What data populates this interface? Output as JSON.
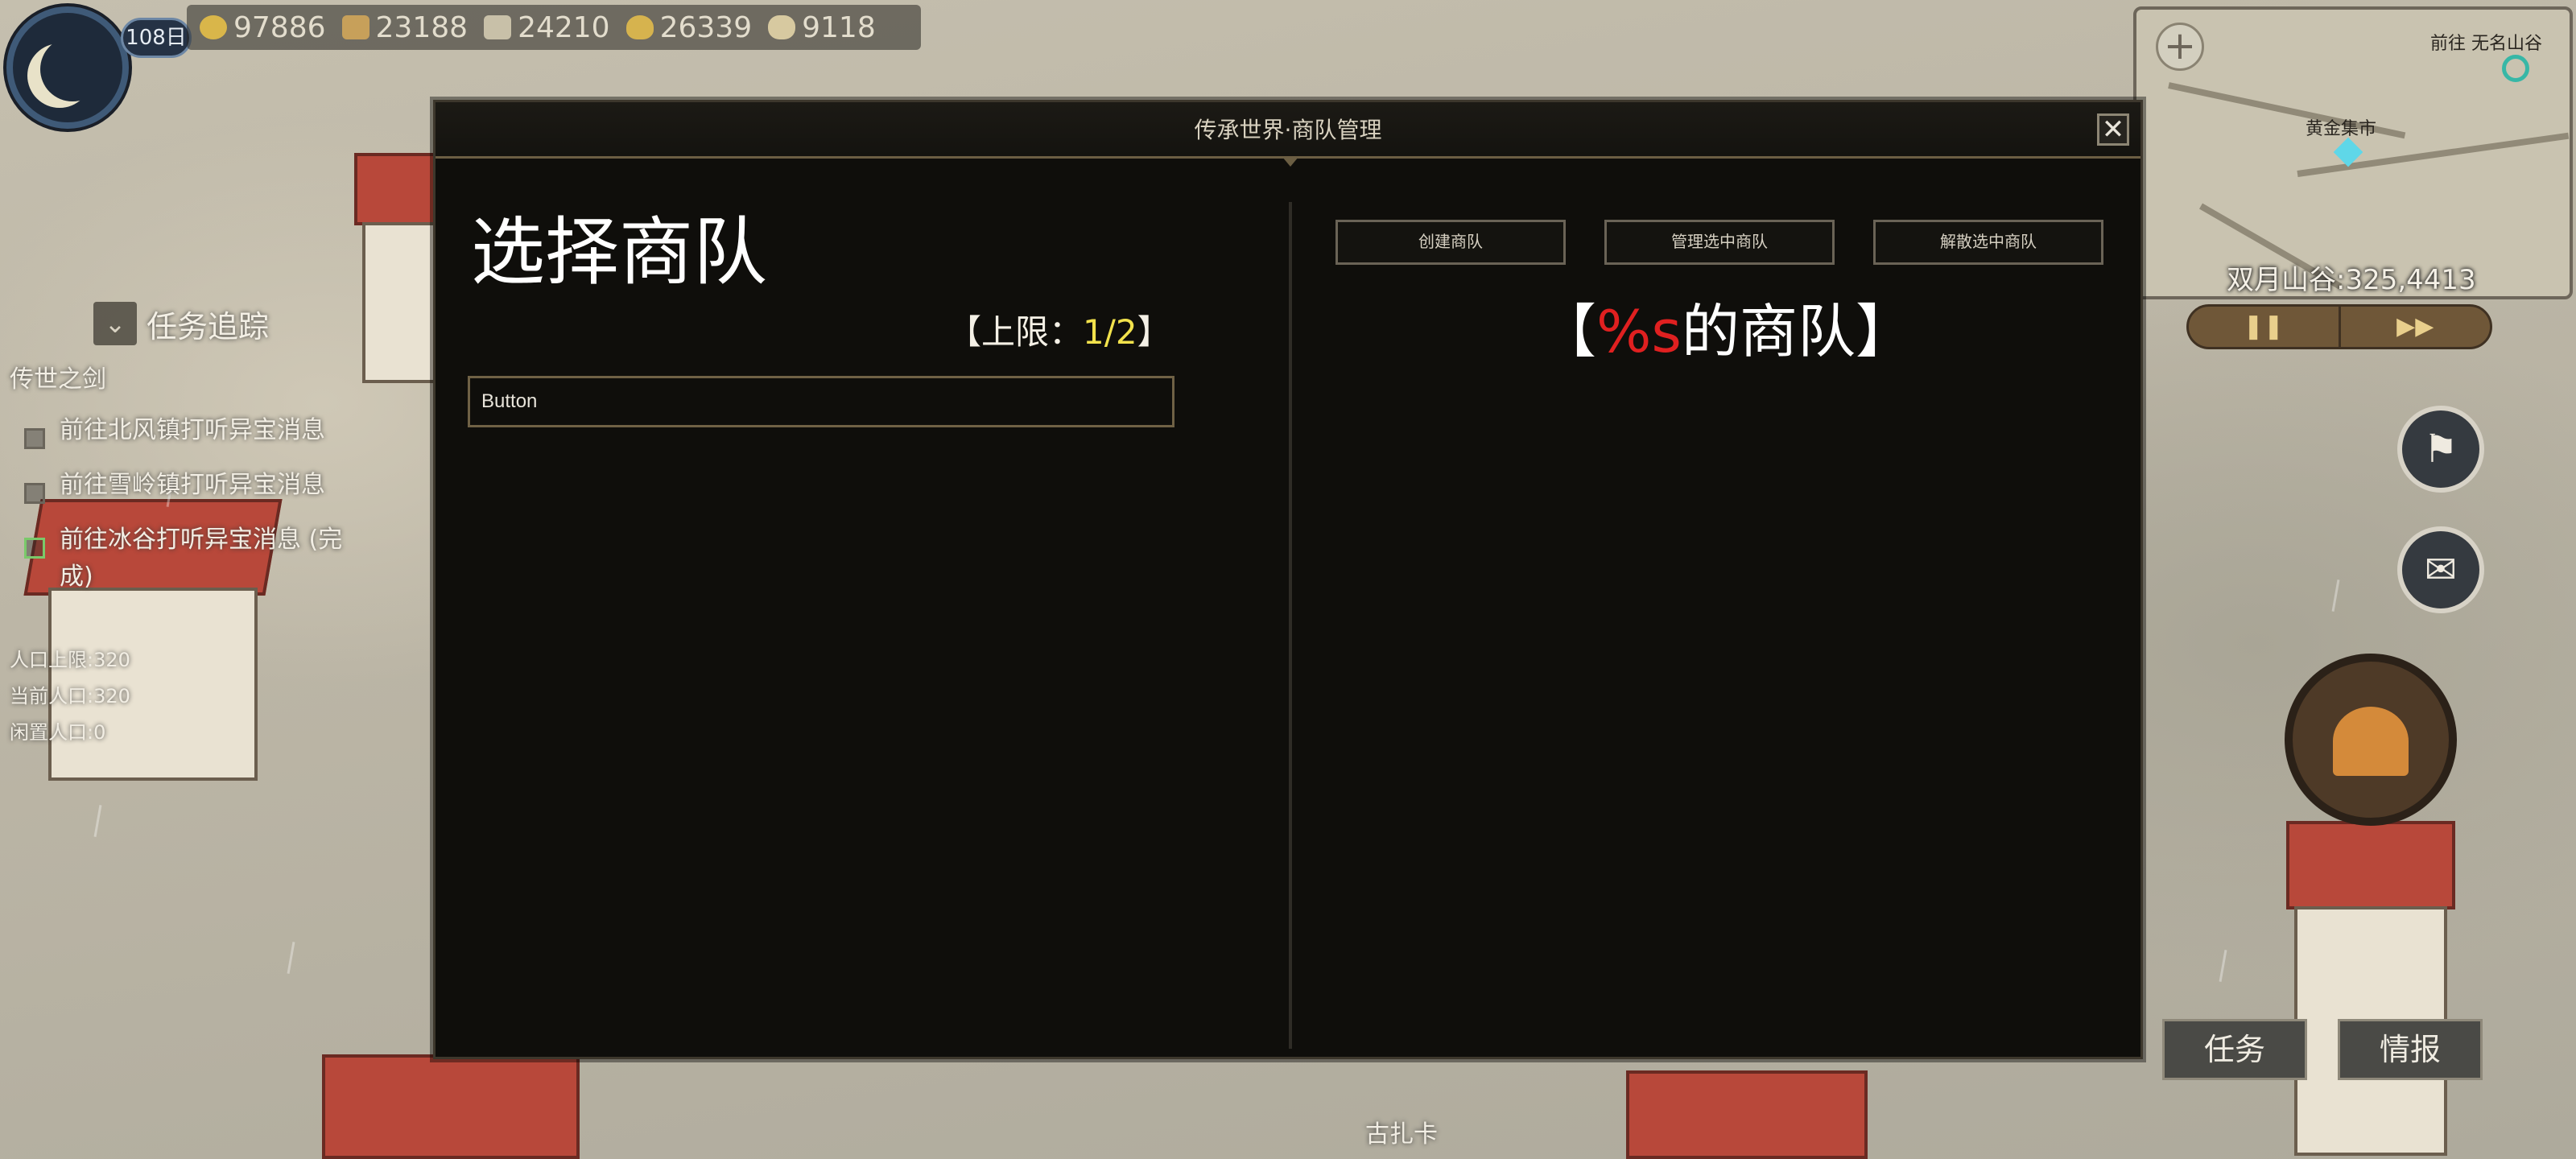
{
  "hud": {
    "day": "108日",
    "resources": [
      {
        "icon": "gold-coin-icon",
        "value": "97886",
        "color": "#d9b64a"
      },
      {
        "icon": "wood-icon",
        "value": "23188",
        "color": "#c7a05a"
      },
      {
        "icon": "stone-icon",
        "value": "24210",
        "color": "#c8c0a8"
      },
      {
        "icon": "food-icon",
        "value": "26339",
        "color": "#d6b34e"
      },
      {
        "icon": "scroll-icon",
        "value": "9118",
        "color": "#d7c9a0"
      }
    ]
  },
  "quests": {
    "title": "任务追踪",
    "chapter": "传世之剑",
    "items": [
      {
        "text": "前往北风镇打听异宝消息",
        "done": false
      },
      {
        "text": "前往雪岭镇打听异宝消息",
        "done": false
      },
      {
        "text": "前往冰谷打听异宝消息 (完成)",
        "done": true
      }
    ],
    "pop_limit": "人口上限:320",
    "pop_current": "当前人口:320",
    "pop_idle": "闲置人口:0"
  },
  "minimap": {
    "destination": "前往 无名山谷",
    "market": "黄金集市",
    "coord": "双月山谷:325,4413",
    "add_icon": "plus-icon"
  },
  "speed": {
    "pause": "❚❚",
    "fast": "▶▶"
  },
  "bottom": {
    "task_button": "任务",
    "intel_button": "情报",
    "place_label": "古扎卡"
  },
  "modal": {
    "title": "传承世界·商队管理",
    "close": "✕",
    "select_title": "选择商队",
    "limit_prefix": "【上限：",
    "limit_value": "1/2",
    "limit_suffix": "】",
    "caravan_button": "Button",
    "create_button": "创建商队",
    "manage_button": "管理选中商队",
    "disband_button": "解散选中商队",
    "right_title_open": "【",
    "right_title_placeholder": "%s",
    "right_title_rest": "的商队】"
  }
}
